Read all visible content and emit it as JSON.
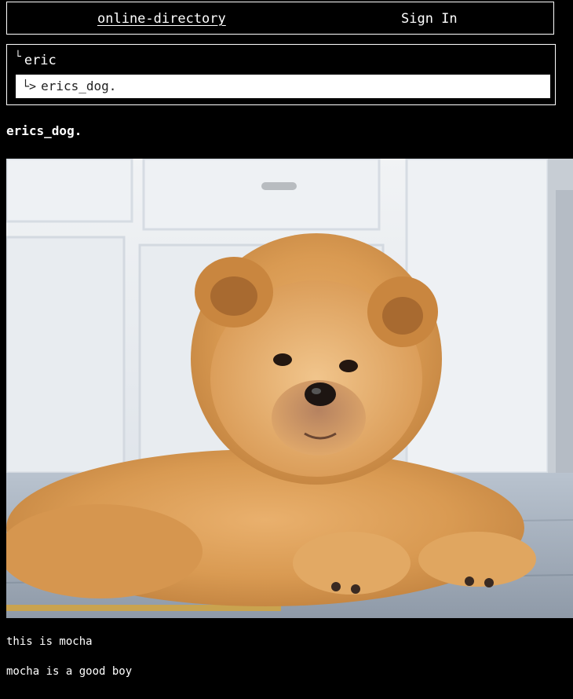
{
  "nav": {
    "home_label": "online-directory",
    "signin_label": "Sign In"
  },
  "breadcrumb": {
    "root_glyph": "└",
    "root_label": "eric",
    "current_glyph": "└>",
    "current_label": "erics_dog."
  },
  "page": {
    "title": "erics_dog.",
    "photo_subject": "fluffy chow chow puppy lying on a tiled floor",
    "lines": [
      "this is mocha",
      "mocha is a good boy"
    ]
  },
  "colors": {
    "background": "#000000",
    "text": "#ffffff",
    "selected_crumb_bg": "#ffffff",
    "selected_crumb_text": "#222222"
  }
}
